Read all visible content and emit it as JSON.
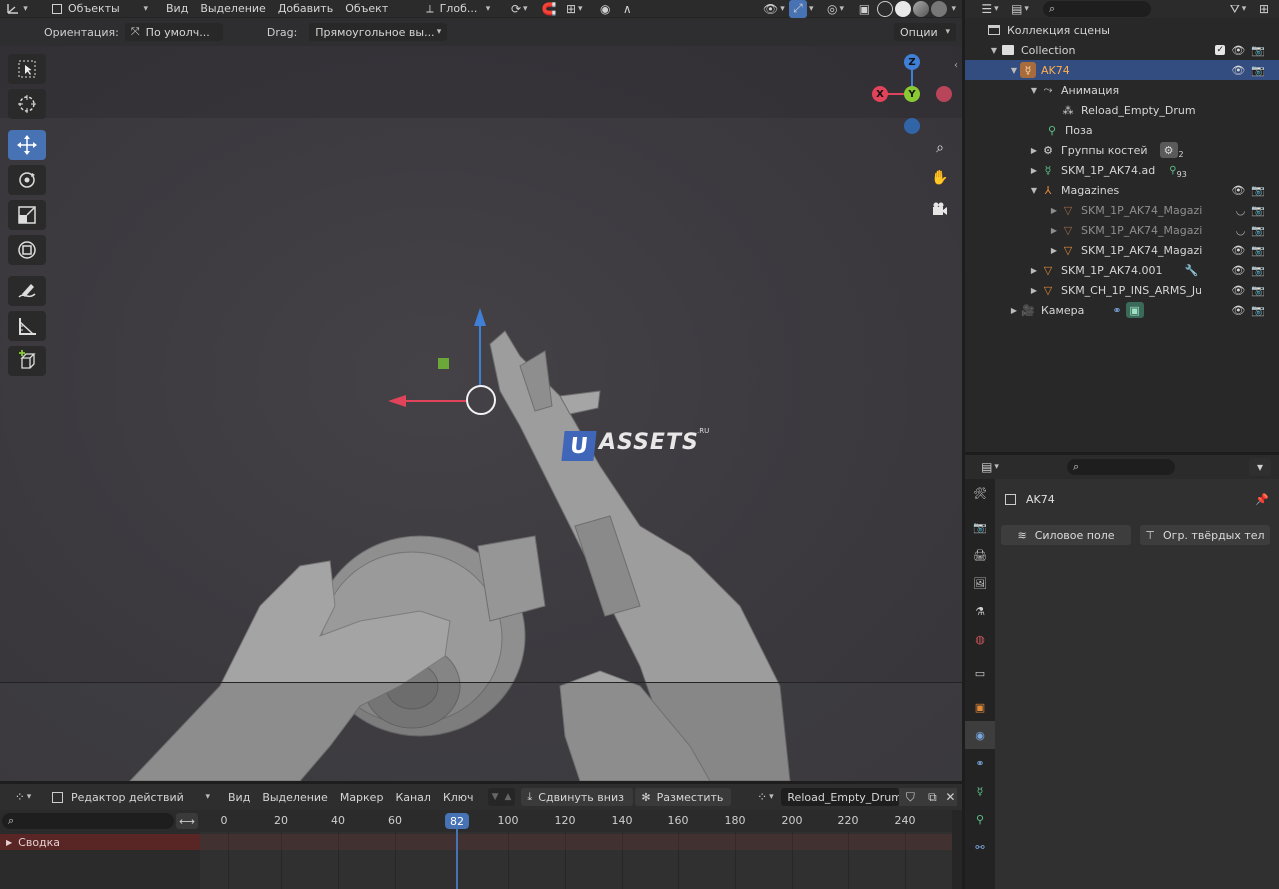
{
  "viewport": {
    "header": {
      "mode": "Объекты",
      "menu": [
        "Вид",
        "Выделение",
        "Добавить",
        "Объект"
      ],
      "transform_space": "Глоб..."
    },
    "tool_settings": {
      "orientation_label": "Ориентация:",
      "orientation_value": "По умолч...",
      "drag_label": "Drag:",
      "drag_value": "Прямоугольное вы...",
      "options": "Опции"
    },
    "gizmo": {
      "z": "Z",
      "y": "Y",
      "x": "X"
    },
    "watermark": {
      "letter": "U",
      "text": "ASSETS",
      "suffix": ".RU"
    }
  },
  "outliner": {
    "rows": [
      {
        "label": "Коллекция сцены",
        "type": "scene-collection"
      },
      {
        "label": "Collection",
        "type": "collection"
      },
      {
        "label": "AK74",
        "type": "armature",
        "selected": true
      },
      {
        "label": "Анимация",
        "type": "animation"
      },
      {
        "label": "Reload_Empty_Drum",
        "type": "action"
      },
      {
        "label": "Поза",
        "type": "pose"
      },
      {
        "label": "Группы костей",
        "type": "bone-groups",
        "badge": "2"
      },
      {
        "label": "SKM_1P_AK74.ad",
        "type": "armature-data",
        "badge": "93"
      },
      {
        "label": "Magazines",
        "type": "empty"
      },
      {
        "label": "SKM_1P_AK74_Magazin",
        "type": "mesh",
        "dim": true
      },
      {
        "label": "SKM_1P_AK74_Magazin",
        "type": "mesh",
        "dim": true
      },
      {
        "label": "SKM_1P_AK74_Magazin",
        "type": "mesh"
      },
      {
        "label": "SKM_1P_AK74.001",
        "type": "mesh"
      },
      {
        "label": "SKM_CH_1P_INS_ARMS_Jugg",
        "type": "mesh"
      },
      {
        "label": "Камера",
        "type": "camera"
      }
    ]
  },
  "properties": {
    "object_name": "AK74",
    "buttons": [
      "Силовое поле",
      "Огр. твёрдых тел"
    ]
  },
  "action_editor": {
    "editor_type": "Редактор действий",
    "menu": [
      "Вид",
      "Выделение",
      "Маркер",
      "Канал",
      "Ключ"
    ],
    "push_down": "Сдвинуть вниз",
    "stash": "Разместить",
    "action_name": "Reload_Empty_Drum",
    "current_frame": "82",
    "frame_labels": [
      "0",
      "20",
      "40",
      "60",
      "100",
      "120",
      "140",
      "160",
      "180",
      "200",
      "220",
      "240"
    ],
    "summary": "Сводка"
  },
  "colors": {
    "accent": "#4772b3",
    "selected_row": "#334d80",
    "object_orange": "#e08a3a",
    "axis_x": "#e0435a",
    "axis_y": "#8bc934",
    "axis_z": "#3f7fd6"
  }
}
